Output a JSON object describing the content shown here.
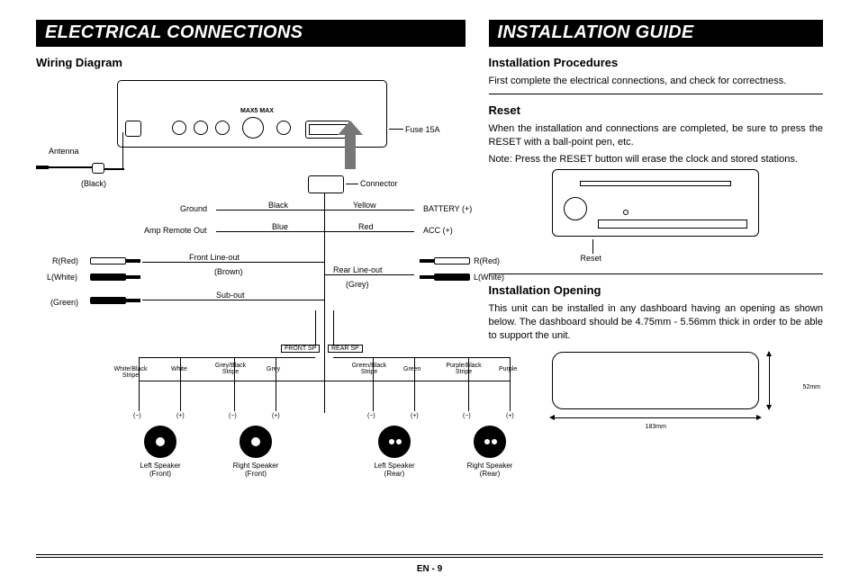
{
  "left": {
    "banner": "ELECTRICAL CONNECTIONS",
    "wiring_h": "Wiring Diagram",
    "labels": {
      "antenna": "Antenna",
      "black_paren": "(Black)",
      "fuse": "Fuse 15A",
      "connector": "Connector",
      "ground": "Ground",
      "amp_remote": "Amp Remote Out",
      "black": "Black",
      "blue": "Blue",
      "yellow": "Yellow",
      "red": "Red",
      "battery": "BATTERY (+)",
      "acc": "ACC (+)",
      "r_red": "R(Red)",
      "l_white": "L(White)",
      "green_paren": "(Green)",
      "front_line": "Front Line-out",
      "brown_paren": "(Brown)",
      "rear_line": "Rear Line-out",
      "grey_paren": "(Grey)",
      "sub_out": "Sub-out",
      "front_sp": "FRONT SP",
      "rear_sp": "REAR SP",
      "minus": "(−)",
      "plus": "(+)",
      "left_spk_f": "Left Speaker",
      "right_spk_f": "Right Speaker",
      "left_spk_r": "Left Speaker",
      "right_spk_r": "Right Speaker",
      "front_paren": "(Front)",
      "rear_paren": "(Rear)",
      "wire_wbs": "White/Black Stripe",
      "wire_white": "White",
      "wire_gbs": "Grey/Black\nStripe",
      "wire_grey": "Grey",
      "wire_grnbs": "Green/Black\nStripe",
      "wire_green": "Green",
      "wire_pbs": "Purple/Black\nStripe",
      "wire_purple": "Purple",
      "max": "MAX5   MAX"
    }
  },
  "right": {
    "banner": "INSTALLATION GUIDE",
    "inst_h": "Installation Procedures",
    "inst_p": "First complete the electrical connections, and check for correctness.",
    "reset_h": "Reset",
    "reset_p1": "When the installation and connections are completed, be sure to press the RESET with a ball-point pen, etc.",
    "reset_p2": "Note: Press the RESET button will erase the clock and stored stations.",
    "reset_lbl": "Reset",
    "open_h": "Installation Opening",
    "open_p": "This unit can be installed in any dashboard having an opening as shown below. The dashboard should be 4.75mm - 5.56mm thick in order to be able to support the unit.",
    "dim_w": "183mm",
    "dim_h": "52mm"
  },
  "footer": {
    "page": "EN - 9"
  }
}
